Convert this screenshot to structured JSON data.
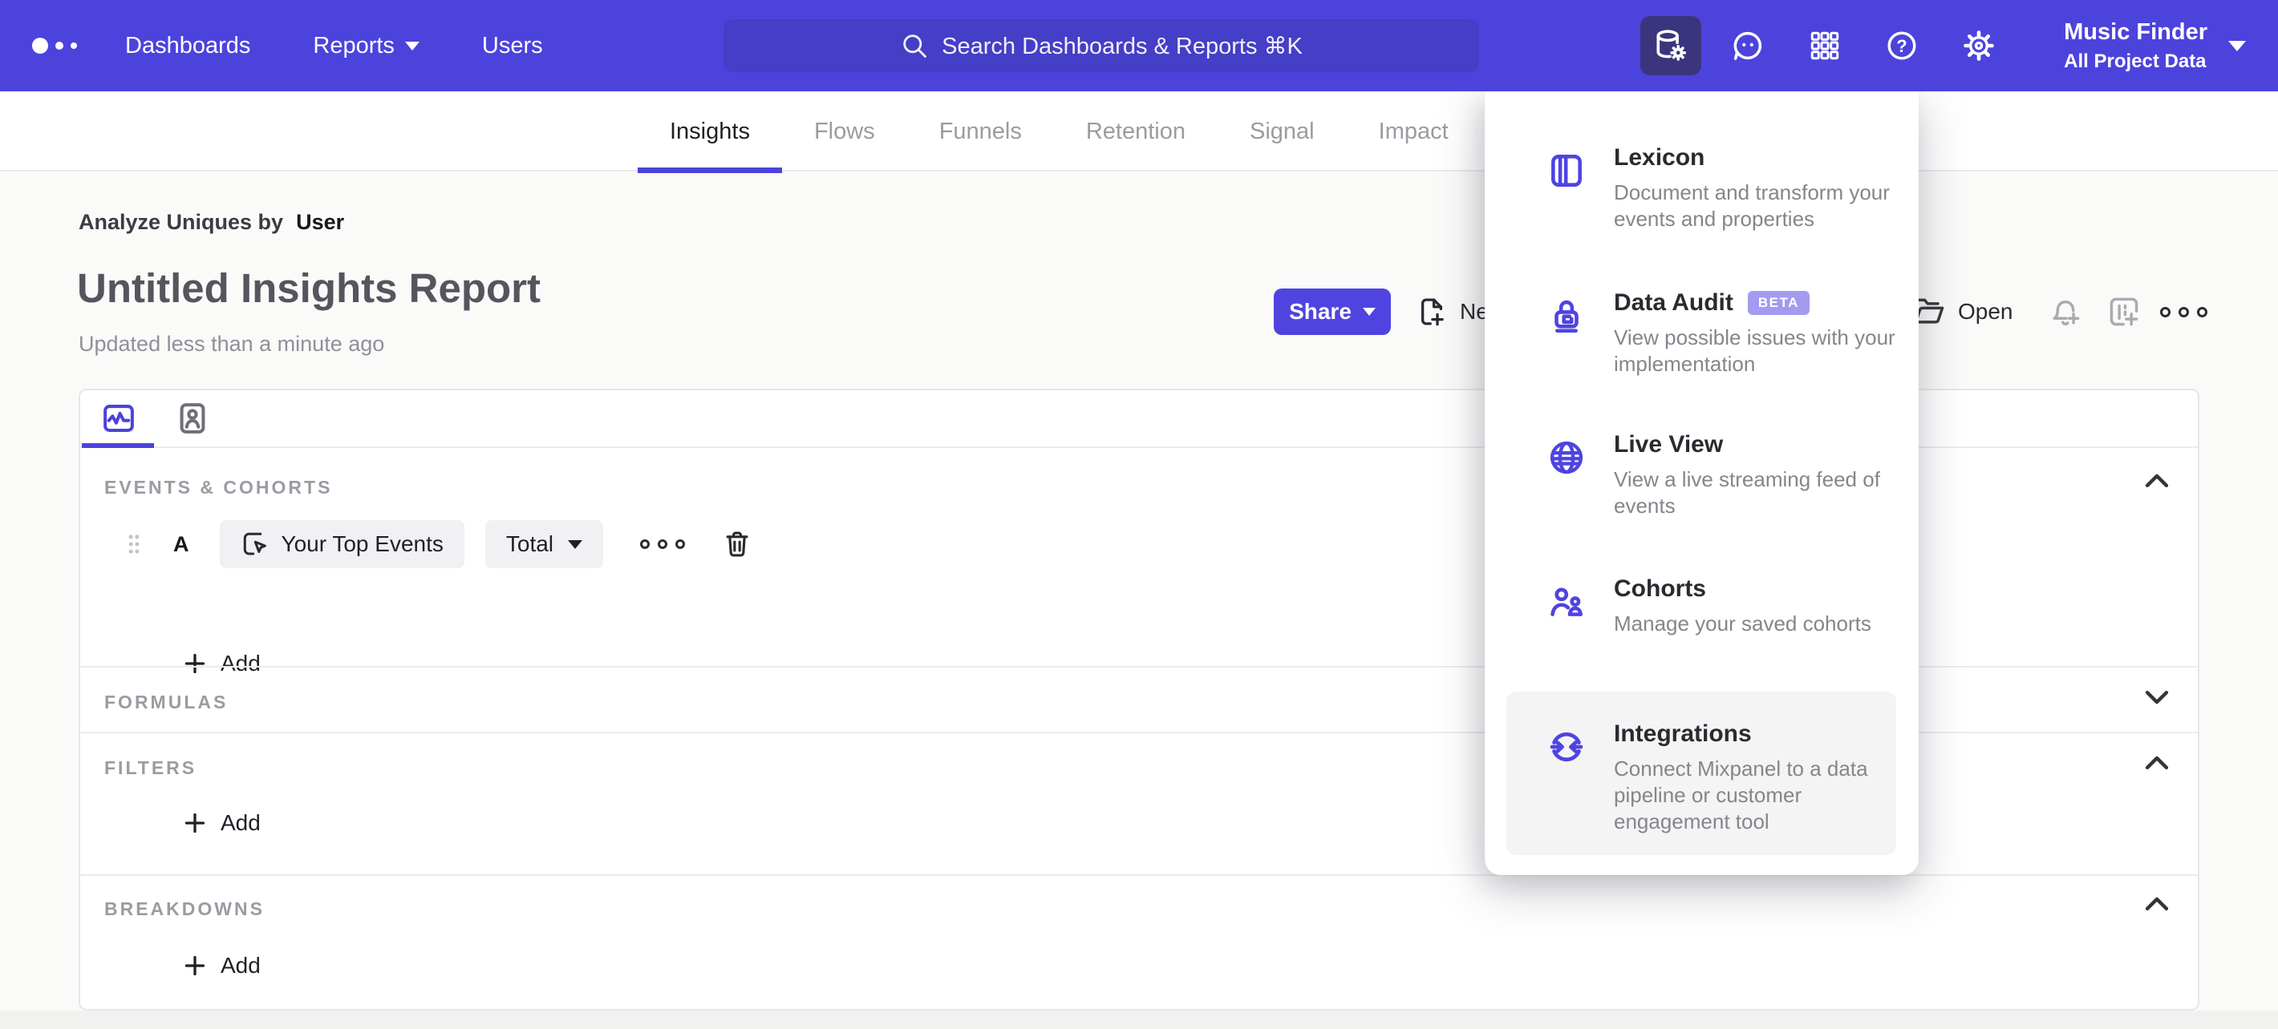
{
  "topbar": {
    "nav": [
      {
        "label": "Dashboards"
      },
      {
        "label": "Reports"
      },
      {
        "label": "Users"
      }
    ],
    "search": {
      "placeholder": "Search Dashboards & Reports ⌘K"
    },
    "icons": [
      "data-management-icon",
      "feedback-icon",
      "apps-grid-icon",
      "help-icon",
      "settings-gear-icon"
    ],
    "project": {
      "name": "Music Finder",
      "scope": "All Project Data"
    }
  },
  "tabbar": {
    "tabs": [
      {
        "label": "Insights",
        "active": true
      },
      {
        "label": "Flows",
        "active": false
      },
      {
        "label": "Funnels",
        "active": false
      },
      {
        "label": "Retention",
        "active": false
      },
      {
        "label": "Signal",
        "active": false
      },
      {
        "label": "Impact",
        "active": false
      }
    ]
  },
  "report": {
    "breadcrumb_prefix": "Analyze Uniques by",
    "breadcrumb_value": "User",
    "title": "Untitled Insights Report",
    "updated": "Updated less than a minute ago",
    "share_label": "Share",
    "new_label": "New",
    "open_label": "Open"
  },
  "builder": {
    "events": {
      "label": "EVENTS & COHORTS",
      "row": {
        "letter": "A",
        "event": "Your Top Events",
        "metric": "Total"
      },
      "add_label": "Add"
    },
    "formulas": {
      "label": "FORMULAS"
    },
    "filters": {
      "label": "FILTERS",
      "add_label": "Add"
    },
    "breakdowns": {
      "label": "BREAKDOWNS",
      "add_label": "Add"
    }
  },
  "menu": {
    "items": [
      {
        "title": "Lexicon",
        "description": "Document and transform your events and properties"
      },
      {
        "title": "Data Audit",
        "badge": "BETA",
        "description": "View possible issues with your implementation"
      },
      {
        "title": "Live View",
        "description": "View a live streaming feed of events"
      },
      {
        "title": "Cohorts",
        "description": "Manage your saved cohorts"
      },
      {
        "title": "Integrations",
        "description": "Connect Mixpanel to a data pipeline or customer engagement tool",
        "hovered": true
      }
    ]
  },
  "colors": {
    "nav_background": "#4c43dc",
    "search_background": "#453ec6",
    "active_tile_background": "#3b357d",
    "accent": "#4f44e0",
    "beta_badge": "#a49af0",
    "hover_item_background": "#f4f4f4",
    "panel_border": "#e7e7ea",
    "section_label": "#9b9ba3"
  }
}
